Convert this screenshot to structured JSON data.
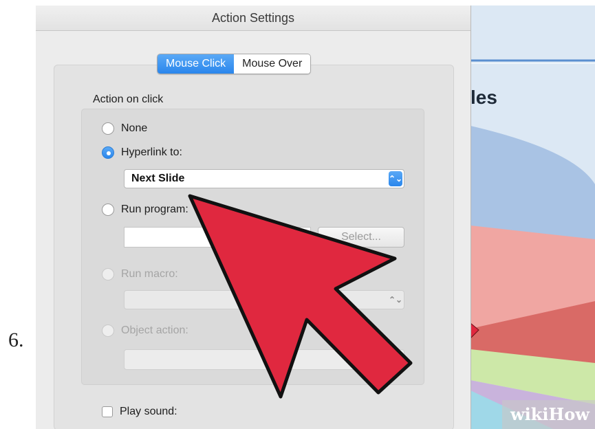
{
  "step_number": "6.",
  "dialog": {
    "title": "Action Settings",
    "tabs": [
      {
        "label": "Mouse Click",
        "active": true
      },
      {
        "label": "Mouse Over",
        "active": false
      }
    ],
    "section_label": "Action on click",
    "options": {
      "none": {
        "label": "None",
        "selected": false,
        "enabled": true
      },
      "hyperlink": {
        "label": "Hyperlink to:",
        "selected": true,
        "enabled": true,
        "value": "Next Slide"
      },
      "run_program": {
        "label": "Run program:",
        "selected": false,
        "enabled": true,
        "select_button": "Select..."
      },
      "run_macro": {
        "label": "Run macro:",
        "selected": false,
        "enabled": false
      },
      "object_action": {
        "label": "Object action:",
        "selected": false,
        "enabled": false
      }
    },
    "play_sound": {
      "label": "Play sound:",
      "checked": false
    }
  },
  "slide": {
    "title_fragment": "les"
  },
  "watermark": {
    "part1": "wiki",
    "part2": "How"
  },
  "colors": {
    "accent_blue": "#2a86ec",
    "arrow_red": "#e0283f",
    "dialog_bg": "#ececec"
  },
  "icons": {
    "popup_arrows": "up-down-chevron-icon",
    "cursor": "red-arrow-pointer-icon"
  }
}
